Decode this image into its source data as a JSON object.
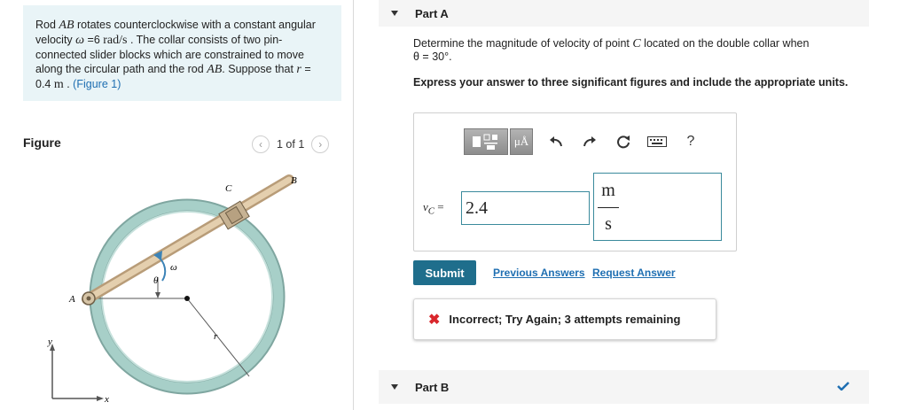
{
  "problem": {
    "t1": "Rod ",
    "rod": "AB",
    "t2": " rotates counterclockwise with a constant angular velocity ",
    "omega": "ω",
    "t3": " =6 ",
    "omega_unit": "rad/s",
    "t4": " . The collar consists of two pin-connected slider blocks which are constrained to move along the circular path and the rod ",
    "rod2": "AB",
    "t5": ". Suppose that ",
    "r": "r",
    "t6": " = 0.4 ",
    "r_unit": "m",
    "t7": " . ",
    "figure_link": "(Figure 1)"
  },
  "figure": {
    "label": "Figure",
    "pager_text": "1 of 1",
    "prev_icon": "chevron-left-icon",
    "next_icon": "chevron-right-icon",
    "labels": {
      "A": "A",
      "B": "B",
      "C": "C",
      "omega": "ω",
      "theta": "θ",
      "r": "r",
      "x": "x",
      "y": "y"
    }
  },
  "partA": {
    "label": "Part A",
    "q1": "Determine the magnitude of velocity of point ",
    "point": "C",
    "q2": " located on the double collar when",
    "q3": "θ = 30°.",
    "instruction": "Express your answer to three significant figures and include the appropriate units.",
    "toolbar": {
      "template_icon": "fraction-template-icon",
      "units_label": "μÅ",
      "undo_icon": "undo-icon",
      "redo_icon": "redo-icon",
      "reset_icon": "reset-icon",
      "keyboard_icon": "keyboard-icon",
      "help_label": "?"
    },
    "variable": "vC",
    "variable_main": "v",
    "variable_sub": "C",
    "equals": "=",
    "value": "2.4",
    "unit_numerator": "m",
    "unit_denominator": "s",
    "submit_label": "Submit",
    "previous_answers": "Previous Answers",
    "request_answer": "Request Answer",
    "feedback": "Incorrect; Try Again; 3 attempts remaining"
  },
  "partB": {
    "label": "Part B"
  },
  "colors": {
    "accent": "#1f6e8c",
    "link": "#1f6fb2",
    "error": "#d9262c",
    "problem_bg": "#e9f4f7",
    "ring": "#a7cfc8"
  }
}
